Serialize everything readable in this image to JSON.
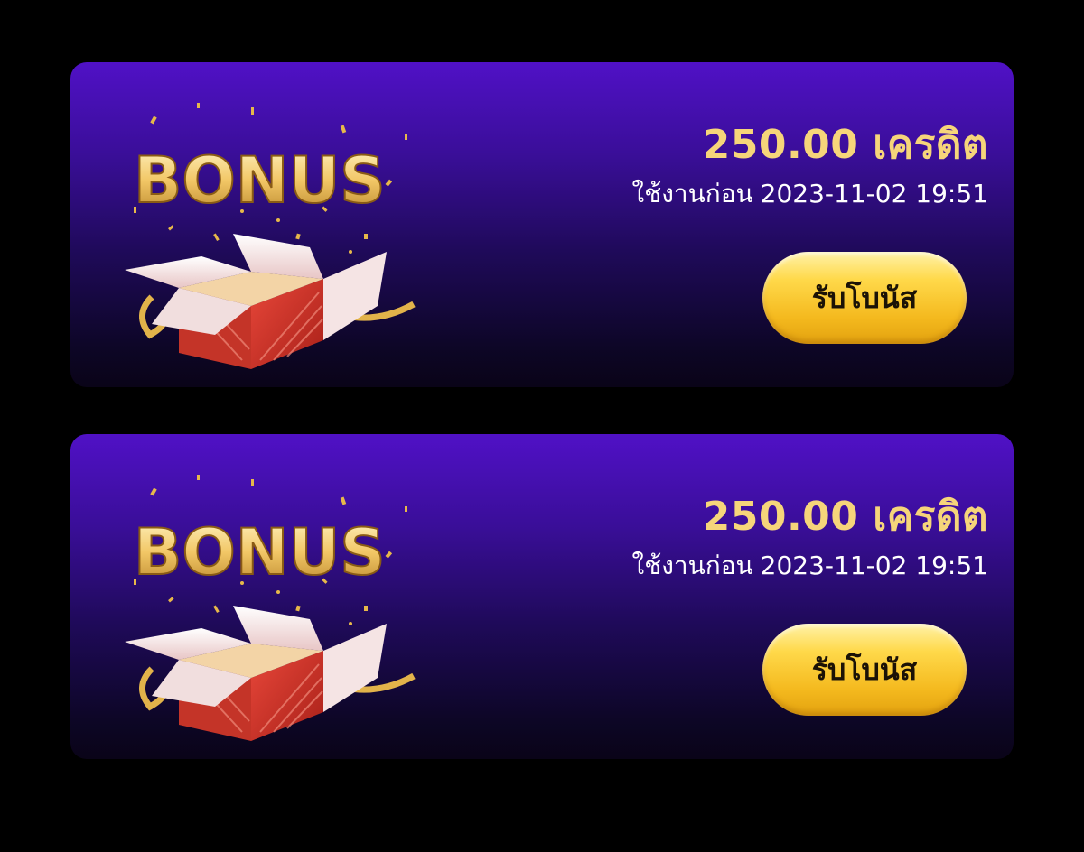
{
  "bonus_cards": [
    {
      "image_label": "BONUS",
      "amount": "250.00 เครดิต",
      "expire_label": "ใช้งานก่อน",
      "expire_datetime": "2023-11-02 19:51",
      "claim_label": "รับโบนัส"
    },
    {
      "image_label": "BONUS",
      "amount": "250.00 เครดิต",
      "expire_label": "ใช้งานก่อน",
      "expire_datetime": "2023-11-02 19:51",
      "claim_label": "รับโบนัส"
    }
  ],
  "colors": {
    "page_background": "#000000",
    "card_gradient_top": "#5011c6",
    "card_gradient_bottom": "#0a0418",
    "amount_text": "#f6d57a",
    "button_gold": "#ffd94a",
    "button_text": "#1b1206"
  }
}
